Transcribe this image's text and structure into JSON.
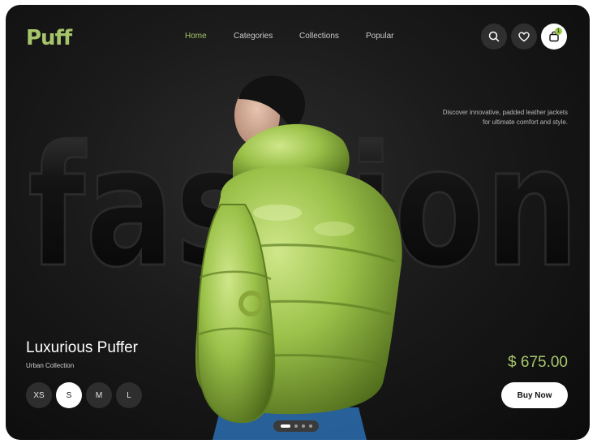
{
  "brand": {
    "logo": "Puff",
    "accent_color": "#a6c56a"
  },
  "nav": {
    "items": [
      {
        "label": "Home",
        "active": true
      },
      {
        "label": "Categories",
        "active": false
      },
      {
        "label": "Collections",
        "active": false
      },
      {
        "label": "Popular",
        "active": false
      }
    ]
  },
  "header_icons": {
    "search": "search-icon",
    "wishlist": "heart-icon",
    "cart": "shopping-bag-icon",
    "cart_count": "1"
  },
  "hero": {
    "background_word": "fashion",
    "tagline_line1": "Discover innovative, padded leather jackets",
    "tagline_line2": "for ultimate comfort and style."
  },
  "product": {
    "title": "Luxurious Puffer",
    "collection": "Urban Collection",
    "sizes": [
      "XS",
      "S",
      "M",
      "L"
    ],
    "selected_size": "S",
    "price": "$ 675.00",
    "buy_label": "Buy Now"
  },
  "carousel": {
    "total": 4,
    "active_index": 0
  }
}
